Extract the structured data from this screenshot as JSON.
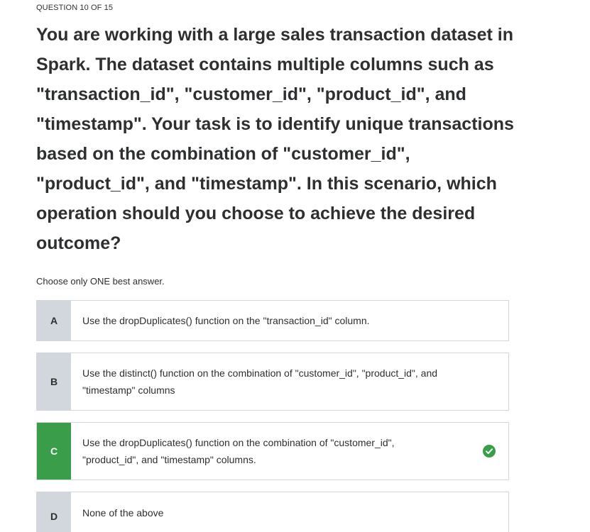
{
  "question": {
    "number_label": "QUESTION 10 OF 15",
    "text": "You are working with a large sales transaction dataset in Spark. The dataset contains multiple columns such as \"transaction_id\", \"customer_id\", \"product_id\", and \"timestamp\". Your task is to identify unique transactions based on the combination of \"customer_id\", \"product_id\", and \"timestamp\". In this scenario, which operation should you choose to achieve the desired outcome?",
    "instruction": "Choose only ONE best answer."
  },
  "options": [
    {
      "letter": "A",
      "text": "Use the dropDuplicates() function on the \"transaction_id\" column.",
      "state": "default"
    },
    {
      "letter": "B",
      "text": "Use the distinct() function on the combination of \"customer_id\", \"product_id\", and \"timestamp\" columns",
      "state": "default"
    },
    {
      "letter": "C",
      "text": "Use the dropDuplicates() function on the combination of \"customer_id\", \"product_id\", and \"timestamp\" columns.",
      "state": "correct"
    },
    {
      "letter": "D",
      "text": "None of the above",
      "state": "default"
    }
  ],
  "colors": {
    "correct": "#3a9d4a",
    "letter_bg": "#d1d7dc",
    "border": "#d1d7dc",
    "text": "#2d2f31"
  },
  "icons": {
    "correct_marker": "check-circle-icon"
  }
}
